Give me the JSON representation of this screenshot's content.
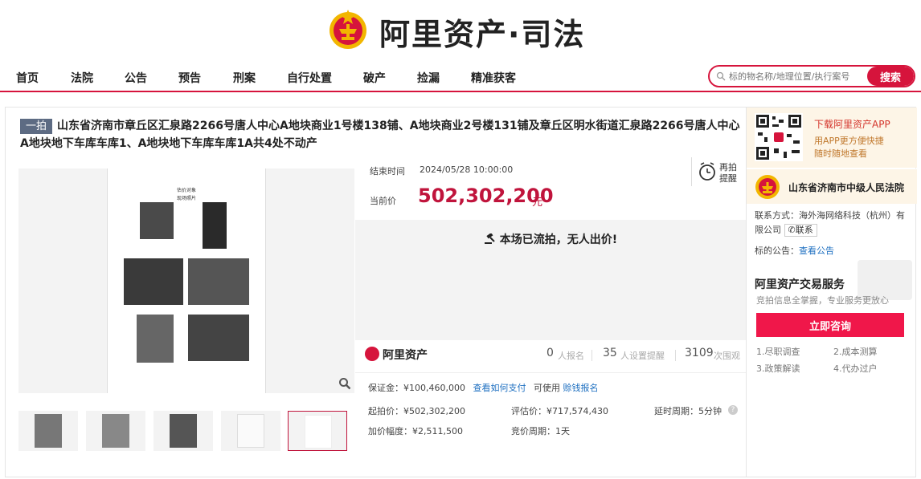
{
  "header": {
    "logo_text": "阿里资产·司法"
  },
  "nav": {
    "items": [
      "首页",
      "法院",
      "公告",
      "预告",
      "刑案",
      "自行处置",
      "破产",
      "捡漏",
      "精准获客"
    ]
  },
  "search": {
    "placeholder": "标的物名称/地理位置/执行案号",
    "button": "搜索"
  },
  "listing": {
    "tag": "一拍",
    "title": "山东省济南市章丘区汇泉路2266号唐人中心A地块商业1号楼138铺、A地块商业2号楼131铺及章丘区明水街道汇泉路2266号唐人中心A地块地下车库车库1、A地块地下车库车库1A共4处不动产",
    "doc_caption_1": "估价对象",
    "doc_caption_2": "现场照片"
  },
  "auction": {
    "end_label": "结束时间",
    "end_value": "2024/05/28 10:00:00",
    "remind_label": "再拍提醒",
    "current_label": "当前价",
    "current_value": "502,302,200",
    "currency_unit": "元",
    "status": "本场已流拍，无人出价!"
  },
  "stats": {
    "brand": "阿里资产",
    "signups": "0",
    "signups_label": "人报名",
    "reminders": "35",
    "reminders_label": "人设置提醒",
    "views": "3109",
    "views_label": "次围观"
  },
  "fees": {
    "deposit": "保证金：¥100,460,000",
    "deposit_link": "查看如何支付",
    "usable": "可使用",
    "loan_link": "赊钱报名",
    "start_price": "起拍价：¥502,302,200",
    "appraisal": "评估价：¥717,574,430",
    "delay": "延时周期：5分钟",
    "increment": "加价幅度：¥2,511,500",
    "bid_cycle": "竞价周期：1天"
  },
  "sidebar": {
    "app_title": "下载阿里资产APP",
    "app_line1": "用APP更方便快捷",
    "app_line2": "随时随地查看",
    "court_name": "山东省济南市中级人民法院",
    "contact_label": "联系方式：",
    "contact_value": "海外海网络科技（杭州）有限公司",
    "contact_button": "联系",
    "notice_label": "标的公告：",
    "notice_link": "查看公告",
    "service_title": "阿里资产交易服务",
    "service_sub": "竞拍信息全掌握，专业服务更放心",
    "consult_button": "立即咨询",
    "features": [
      "1.尽职调查",
      "2.成本测算",
      "3.政策解读",
      "4.代办过户"
    ]
  },
  "colors": {
    "brand_red": "#d6143c",
    "price_red": "#c0143c"
  }
}
